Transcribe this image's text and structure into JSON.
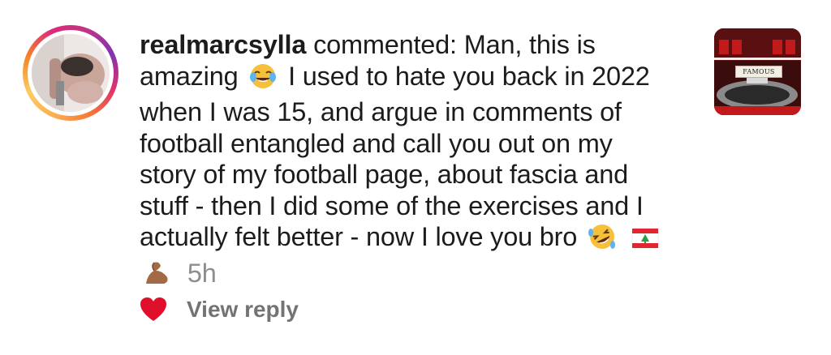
{
  "comment": {
    "username": "realmarcsylla",
    "verb": "commented:",
    "text_part1": "Man, this is amazing",
    "text_part2": "I used to hate you back in 2022 when I was 15, and argue in comments of football entangled and call you out on my story of my football page, about fascia and stuff - then I did some of the exercises and I actually felt better - now I love you bro",
    "emojis": [
      "face-with-tears-of-joy",
      "rolling-on-the-floor-laughing",
      "flag-lebanon",
      "flexed-biceps"
    ],
    "time": "5h"
  },
  "thumbnail": {
    "label": "FAMOUS"
  },
  "actions": {
    "liked": true,
    "heart_color": "#e0102c",
    "view_reply_label": "View reply"
  }
}
